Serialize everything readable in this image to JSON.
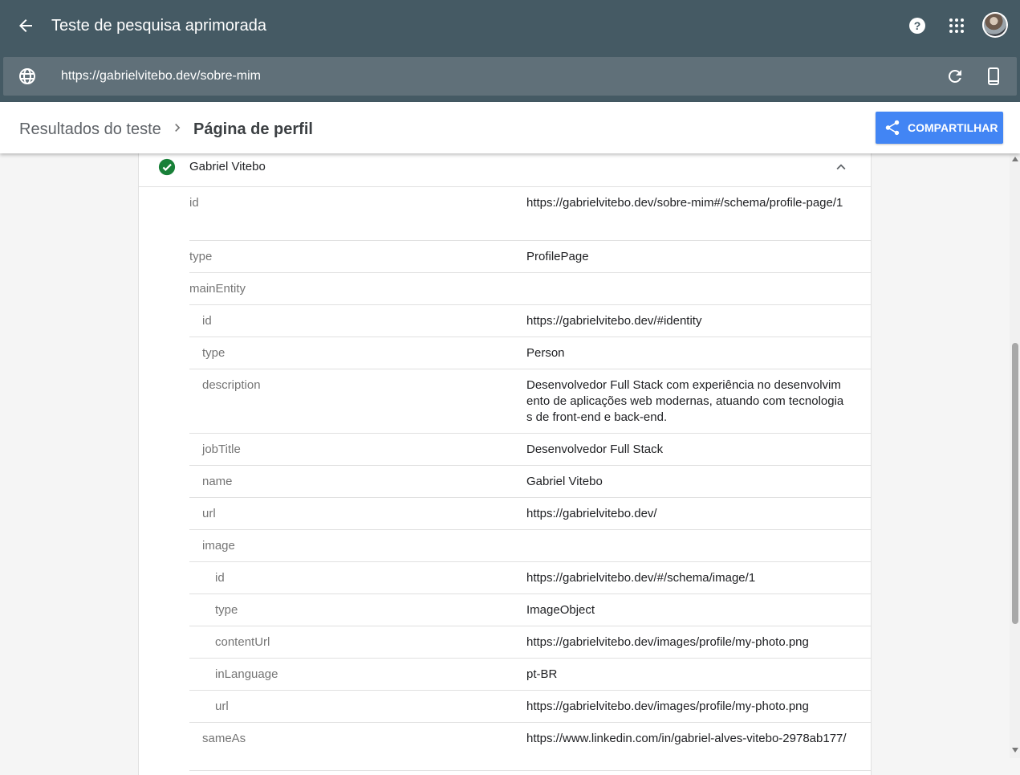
{
  "header": {
    "title": "Teste de pesquisa aprimorada",
    "url": "https://gabrielvitebo.dev/sobre-mim"
  },
  "breadcrumb": {
    "parent": "Resultados do teste",
    "current": "Página de perfil"
  },
  "share_label": "COMPARTILHAR",
  "item": {
    "title": "Gabriel Vitebo",
    "status": "valid",
    "status_color": "#188038"
  },
  "properties": [
    {
      "name": "id",
      "value": "https://gabrielvitebo.dev/sobre-mim#/schema/profile-page/1",
      "level": 0
    },
    {
      "name": "type",
      "value": "ProfilePage",
      "level": 0
    },
    {
      "name": "mainEntity",
      "value": "",
      "level": 0
    },
    {
      "name": "id",
      "value": "https://gabrielvitebo.dev/#identity",
      "level": 1
    },
    {
      "name": "type",
      "value": "Person",
      "level": 1
    },
    {
      "name": "description",
      "value": "Desenvolvedor Full Stack com experiência no desenvolvimento de aplicações web modernas, atuando com tecnologias de front-end e back-end.",
      "level": 1
    },
    {
      "name": "jobTitle",
      "value": "Desenvolvedor Full Stack",
      "level": 1
    },
    {
      "name": "name",
      "value": "Gabriel Vitebo",
      "level": 1
    },
    {
      "name": "url",
      "value": "https://gabrielvitebo.dev/",
      "level": 1
    },
    {
      "name": "image",
      "value": "",
      "level": 1
    },
    {
      "name": "id",
      "value": "https://gabrielvitebo.dev/#/schema/image/1",
      "level": 2
    },
    {
      "name": "type",
      "value": "ImageObject",
      "level": 2
    },
    {
      "name": "contentUrl",
      "value": "https://gabrielvitebo.dev/images/profile/my-photo.png",
      "level": 2
    },
    {
      "name": "inLanguage",
      "value": "pt-BR",
      "level": 2
    },
    {
      "name": "url",
      "value": "https://gabrielvitebo.dev/images/profile/my-photo.png",
      "level": 2
    },
    {
      "name": "sameAs",
      "value": "https://www.linkedin.com/in/gabriel-alves-vitebo-2978ab177/",
      "level": 1
    }
  ],
  "colors": {
    "header_bg": "#455a64",
    "accent": "#4285f4"
  }
}
